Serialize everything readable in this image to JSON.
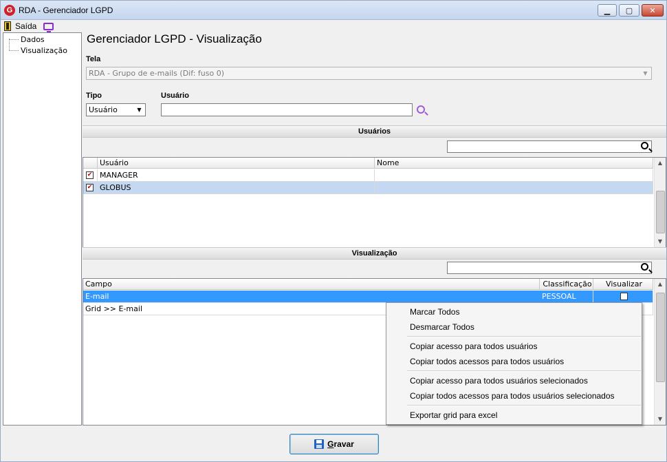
{
  "window": {
    "title": "RDA - Gerenciador LGPD",
    "app_icon_letter": "G"
  },
  "menu": {
    "exit_label": "Saída"
  },
  "tree": {
    "items": [
      "Dados",
      "Visualização"
    ]
  },
  "main": {
    "page_title": "Gerenciador LGPD - Visualização",
    "tela_label": "Tela",
    "tela_value": "RDA - Grupo de e-mails (Dif: fuso 0)",
    "tipo_label": "Tipo",
    "tipo_value": "Usuário",
    "usuario_label": "Usuário",
    "usuario_value": ""
  },
  "users_section": {
    "title": "Usuários",
    "search_value": "",
    "columns": [
      "Usuário",
      "Nome"
    ],
    "rows": [
      {
        "usuario": "MANAGER",
        "nome": "",
        "checked": true,
        "selected": false
      },
      {
        "usuario": "GLOBUS",
        "nome": "",
        "checked": true,
        "selected": true
      }
    ]
  },
  "view_section": {
    "title": "Visualização",
    "search_value": "",
    "columns": [
      "Campo",
      "Classificação",
      "Visualizar"
    ],
    "rows": [
      {
        "campo": "E-mail",
        "classificacao": "PESSOAL",
        "selected": true
      },
      {
        "campo": "Grid >> E-mail",
        "classificacao": "",
        "selected": false
      }
    ]
  },
  "context_menu": {
    "items": [
      "Marcar Todos",
      "Desmarcar Todos",
      "Copiar acesso para todos usuários",
      "Copiar todos acessos para todos usuários",
      "Copiar acesso para todos usuários selecionados",
      "Copiar todos acessos para todos usuários selecionados",
      "Exportar grid para excel"
    ]
  },
  "footer": {
    "save_label_accel": "G",
    "save_label_rest": "ravar"
  },
  "colors": {
    "selection": "#3399ff",
    "row_highlight": "#c5d8f1",
    "check": "#c00000"
  }
}
